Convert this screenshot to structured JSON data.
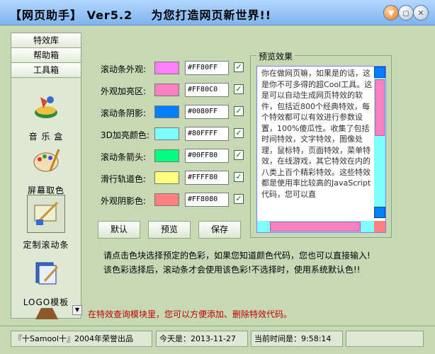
{
  "window": {
    "title": "【网页助手】 Ver5.2    为您打造网页新世界!!"
  },
  "sidebar": {
    "tabs": [
      "特效库",
      "帮助箱",
      "工具箱"
    ],
    "tools": [
      {
        "label": "音 乐 盒",
        "icon": "music-box-icon"
      },
      {
        "label": "屏幕取色",
        "icon": "color-picker-icon"
      },
      {
        "label": "定制滚动条",
        "icon": "scrollbar-icon"
      },
      {
        "label": "LOGO模板",
        "icon": "logo-template-icon"
      }
    ]
  },
  "color_rows": [
    {
      "label": "滚动条外观:",
      "hex": "#FF80FF",
      "checked": true
    },
    {
      "label": "外观加亮区:",
      "hex": "#FF80C0",
      "checked": true
    },
    {
      "label": "滚动条阴影:",
      "hex": "#0080FF",
      "checked": true
    },
    {
      "label": "3D加亮颜色:",
      "hex": "#80FFFF",
      "checked": true
    },
    {
      "label": "滚动条箭头:",
      "hex": "#00FF80",
      "checked": true
    },
    {
      "label": "滑行轨道色:",
      "hex": "#FFFF80",
      "checked": true
    },
    {
      "label": "外观阴影色:",
      "hex": "#FF8080",
      "checked": true
    }
  ],
  "buttons": {
    "default": "默认",
    "preview": "预览",
    "save": "保存"
  },
  "preview": {
    "title": "预览效果",
    "text": "你在做网页嘛，如果是的话，这是你不可多得的超Cool工具。这是可以自动生成网页特效的软件，包括近800个经典特效，每个特效都可以有效进行参数设置，100%傻瓜性。收集了包括时间特效，文字特效，图像处理，鼠标特，页面特效，菜单特效，在线游戏，其它特效在内的八类上百个精彩特效。这些特效都是使用率比较高的JavaScript代码，您可以直"
  },
  "hints": {
    "line1": "请点击色块选择预定的色彩，如果您知道颜色代码，您也可以直接输入!",
    "line2": "该色彩选择后，滚动条才会使用该色彩!不选择时，使用系统默认色!!"
  },
  "status_message": "在特效查询模块里，您可以方便添加、删除特效代码。",
  "statusbar": {
    "credit": "『十Samool十』2004年荣誉出品",
    "today": "今天是：2013-11-27",
    "now": "当前时间是：9:58:14"
  },
  "colors": {
    "bg": "#c6d8b4",
    "status_red": "#c00000",
    "scroll_face": "#FF80FF"
  }
}
